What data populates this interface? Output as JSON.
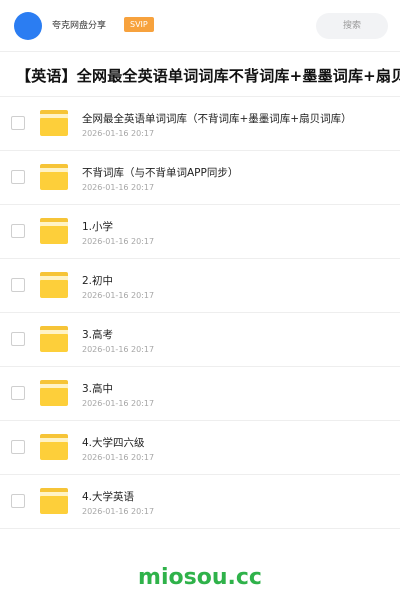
{
  "header": {
    "user_name": "夸克网盘分享",
    "badge": "SVIP",
    "search_placeholder": "搜索",
    "accent_color": "#2b7df2"
  },
  "page_title": "【英语】全网最全英语单词词库不背词库+墨墨词库+扇贝词库",
  "items": [
    {
      "name": "全网最全英语单词词库（不背词库+墨墨词库+扇贝词库）",
      "date": "2026-01-16 20:17",
      "icon": "folder-icon"
    },
    {
      "name": "不背词库（与不背单词APP同步）",
      "date": "2026-01-16 20:17",
      "icon": "folder-icon"
    },
    {
      "name": "1.小学",
      "date": "2026-01-16 20:17",
      "icon": "folder-icon"
    },
    {
      "name": "2.初中",
      "date": "2026-01-16 20:17",
      "icon": "folder-icon"
    },
    {
      "name": "3.高考",
      "date": "2026-01-16 20:17",
      "icon": "folder-icon"
    },
    {
      "name": "3.高中",
      "date": "2026-01-16 20:17",
      "icon": "folder-icon"
    },
    {
      "name": "4.大学四六级",
      "date": "2026-01-16 20:17",
      "icon": "folder-icon"
    },
    {
      "name": "4.大学英语",
      "date": "2026-01-16 20:17",
      "icon": "folder-icon"
    }
  ],
  "footer": {
    "watermark": "miosou.cc",
    "color": "#2fb24a"
  }
}
